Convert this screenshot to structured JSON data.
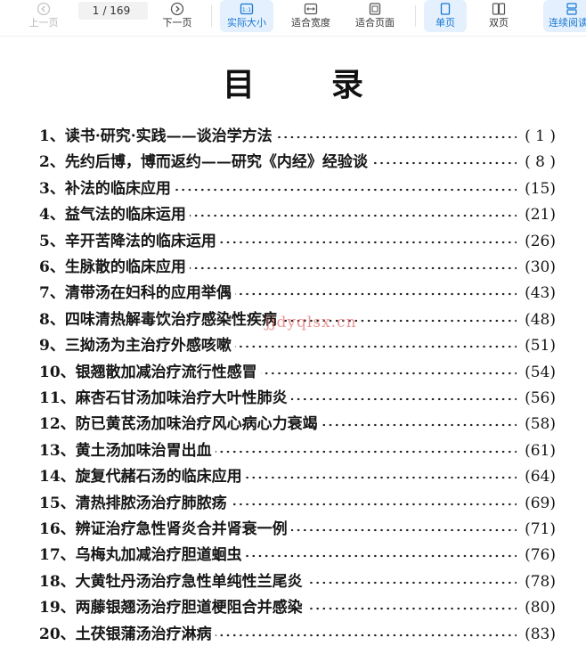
{
  "toolbar": {
    "prev_label": "上一页",
    "next_label": "下一页",
    "current_page": "1",
    "total_pages": "/ 169",
    "actual_size_label": "实际大小",
    "fit_width_label": "适合宽度",
    "fit_page_label": "适合页面",
    "single_page_label": "单页",
    "double_page_label": "双页",
    "continuous_label": "连续阅读",
    "accent_color": "#1677d2"
  },
  "document": {
    "title_char_1": "目",
    "title_char_2": "录",
    "watermark": "jjdyqlsx.cn",
    "entries": [
      {
        "text": "1、读书·研究·实践——谈治学方法",
        "page": "( 1 )"
      },
      {
        "text": "2、先约后博，博而返约——研究《内经》经验谈",
        "page": "( 8 )"
      },
      {
        "text": "3、补法的临床应用",
        "page": "(15)"
      },
      {
        "text": "4、益气法的临床运用",
        "page": "(21)"
      },
      {
        "text": "5、辛开苦降法的临床运用",
        "page": "(26)"
      },
      {
        "text": "6、生脉散的临床应用",
        "page": "(30)"
      },
      {
        "text": "7、清带汤在妇科的应用举偶",
        "page": "(43)"
      },
      {
        "text": "8、四味清热解毒饮治疗感染性疾病",
        "page": "(48)"
      },
      {
        "text": "9、三拗汤为主治疗外感咳嗽",
        "page": "(51)"
      },
      {
        "text": "10、银翘散加减治疗流行性感冒",
        "page": "(54)"
      },
      {
        "text": "11、麻杏石甘汤加味治疗大叶性肺炎",
        "page": "(56)"
      },
      {
        "text": "12、防已黄芪汤加味治疗风心病心力衰竭",
        "page": "(58)"
      },
      {
        "text": "13、黄土汤加味治胃出血",
        "page": "(61)"
      },
      {
        "text": "14、旋复代赭石汤的临床应用",
        "page": "(64)"
      },
      {
        "text": "15、清热排脓汤治疗肺脓疡",
        "page": "(69)"
      },
      {
        "text": "16、辨证治疗急性肾炎合并肾衰一例",
        "page": "(71)"
      },
      {
        "text": "17、乌梅丸加减治疗胆道蛔虫",
        "page": "(76)"
      },
      {
        "text": "18、大黄牡丹汤治疗急性单纯性兰尾炎",
        "page": "(78)"
      },
      {
        "text": "19、两藤银翘汤治疗胆道梗阻合并感染",
        "page": "(80)"
      },
      {
        "text": "20、土茯银蒲汤治疗淋病",
        "page": "(83)"
      }
    ]
  }
}
